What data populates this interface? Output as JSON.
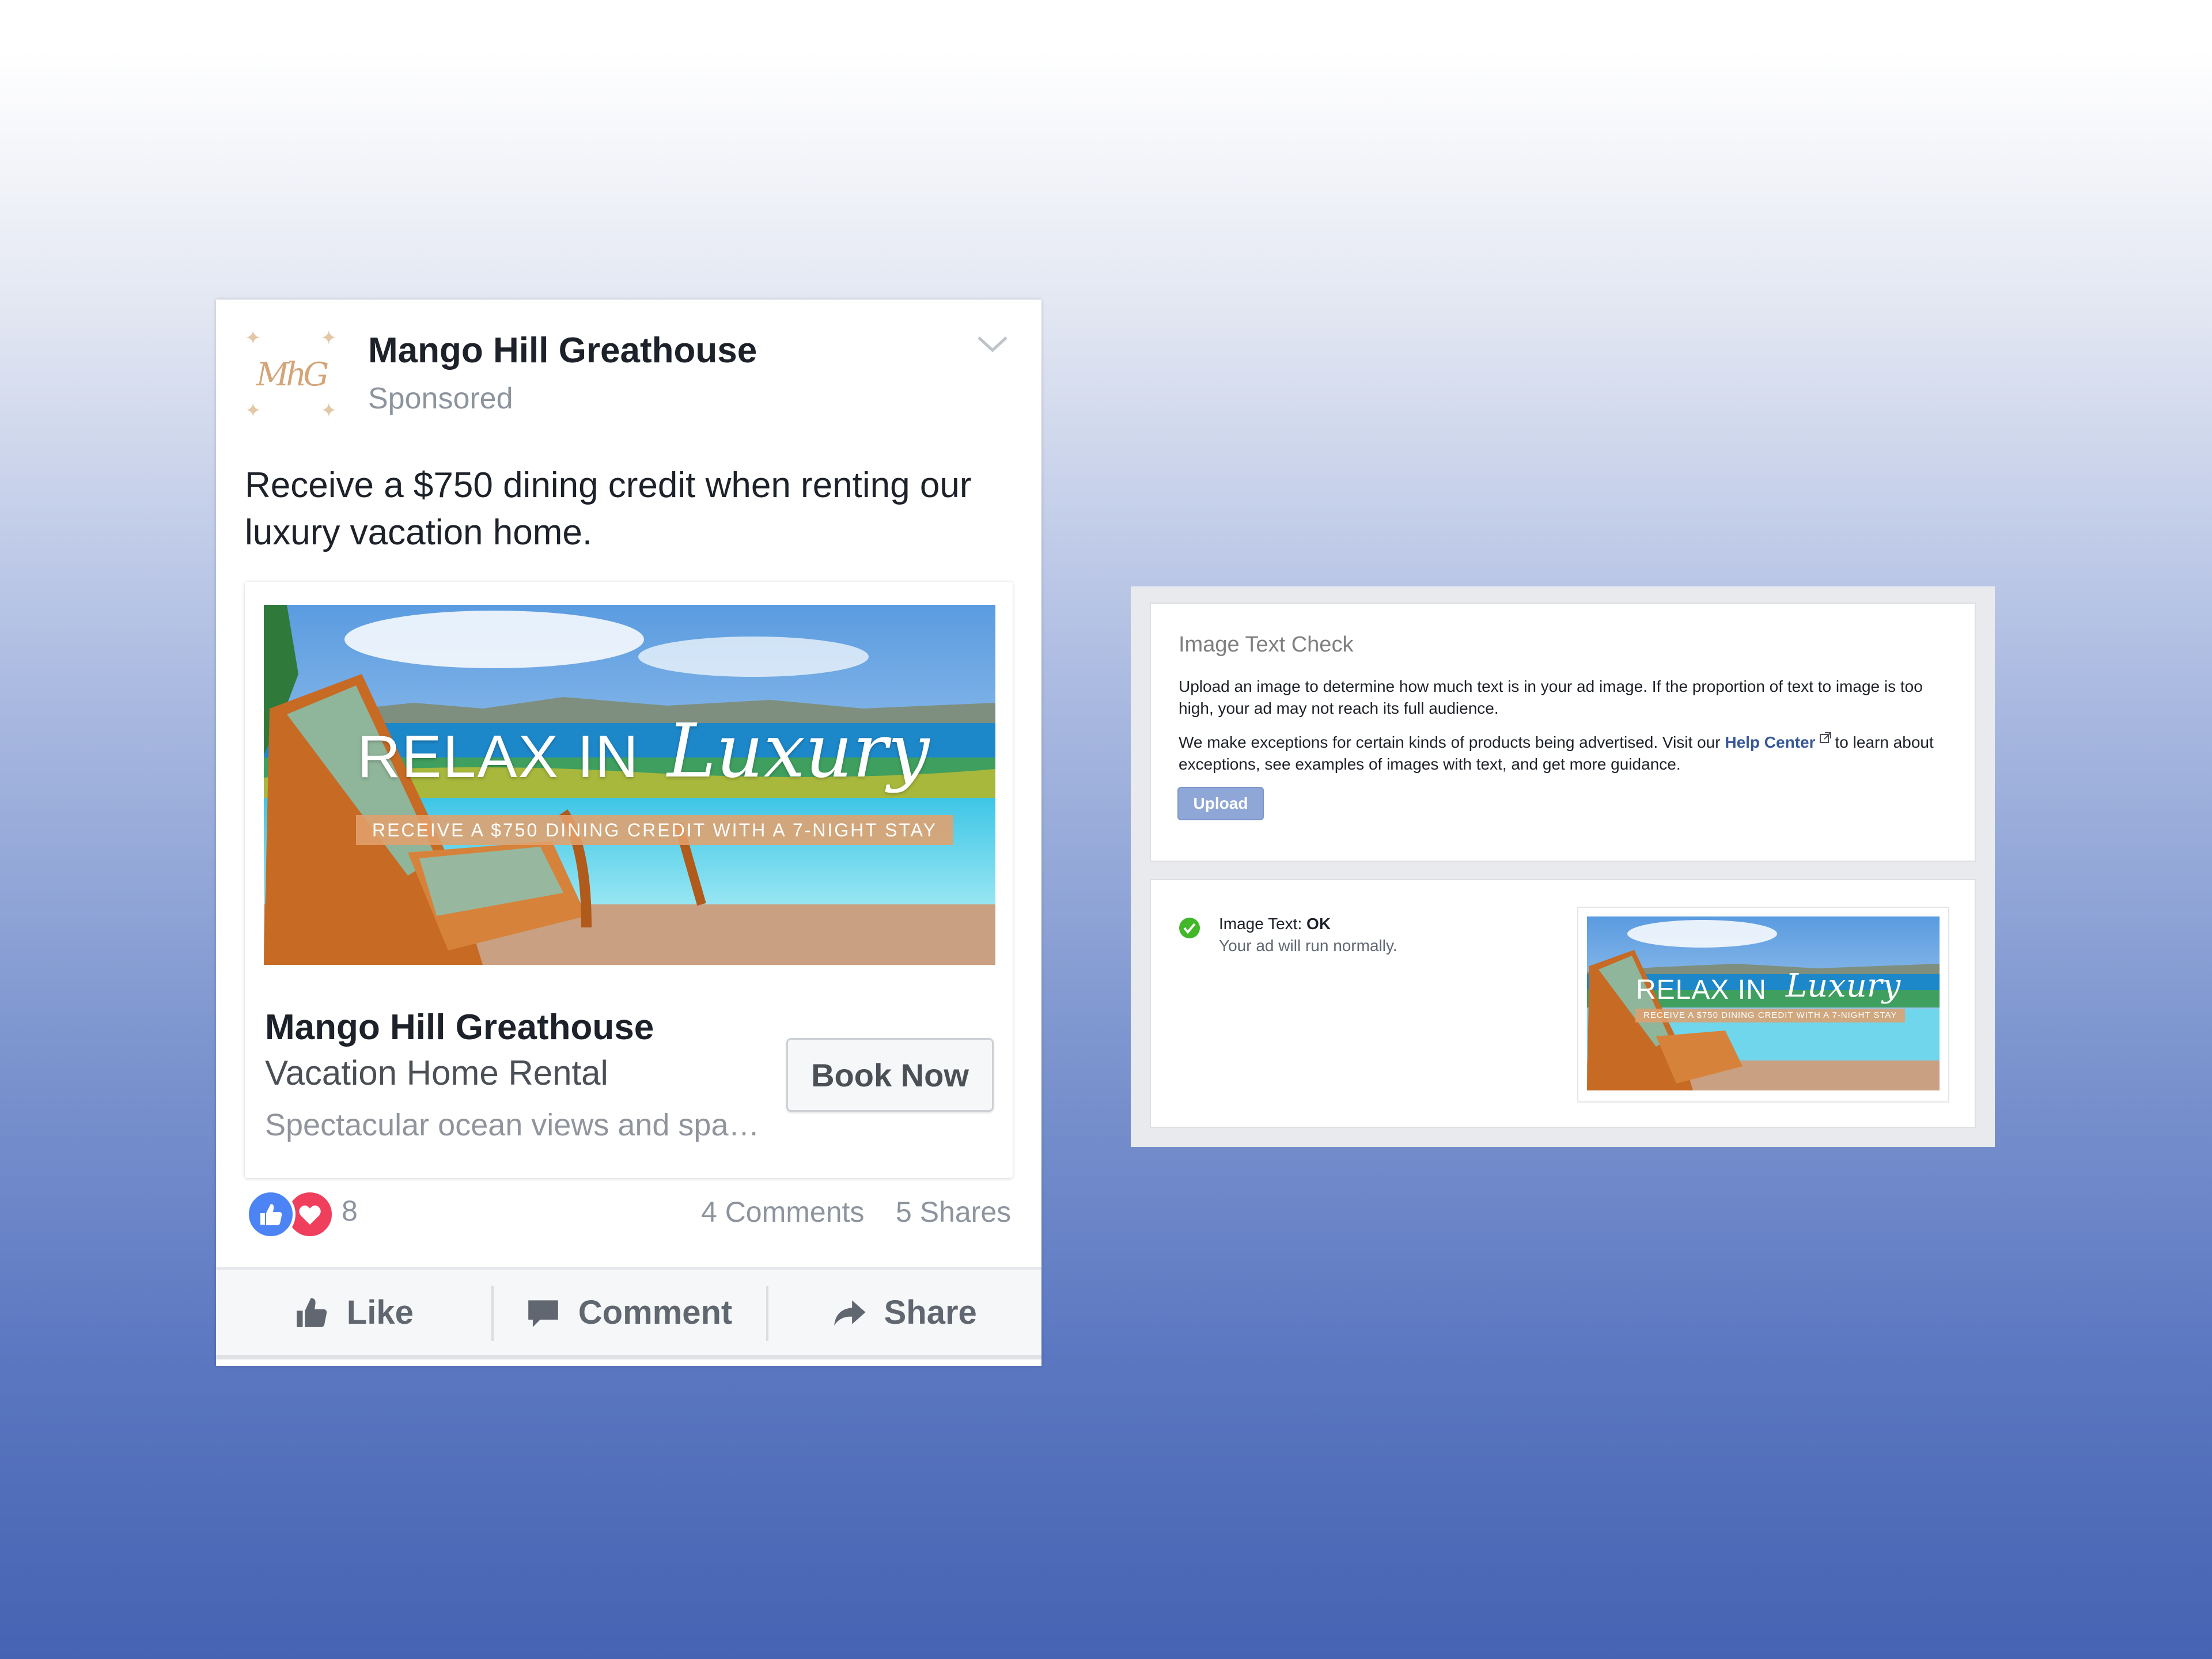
{
  "post": {
    "page_name": "Mango Hill Greathouse",
    "sponsored": "Sponsored",
    "logo_monogram": "MhG",
    "text": "Receive a $750 dining credit when renting our luxury vacation home.",
    "image": {
      "headline": "RELAX IN",
      "script": "Luxury",
      "band": "RECEIVE A $750 DINING CREDIT WITH A 7-NIGHT STAY"
    },
    "link": {
      "title": "Mango Hill Greathouse",
      "subtitle": "Vacation Home Rental",
      "description": "Spectacular ocean views and spa…",
      "cta": "Book Now"
    },
    "stats": {
      "reaction_count": "8",
      "comments": "4 Comments",
      "shares": "5 Shares"
    },
    "actions": {
      "like": "Like",
      "comment": "Comment",
      "share": "Share"
    }
  },
  "text_check": {
    "title": "Image Text Check",
    "paragraph1": "Upload an image to determine how much text is in your ad image. If the proportion of text to image is too high, your ad may not reach its full audience.",
    "paragraph2_before": "We make exceptions for certain kinds of products being advertised. Visit our",
    "help_link": "Help Center",
    "paragraph2_after": "to learn about exceptions, see examples of images with text, and get more guidance.",
    "upload_label": "Upload",
    "result_label": "Image Text:",
    "result_value": "OK",
    "result_sub": "Your ad will run normally.",
    "thumb": {
      "headline": "RELAX IN",
      "script": "Luxury",
      "band": "RECEIVE A $750 DINING CREDIT WITH A 7-NIGHT STAY"
    }
  },
  "colors": {
    "like_blue": "#4d84f5",
    "love_red": "#ef3f5d",
    "link_blue": "#365899",
    "ok_green": "#42b72a",
    "upload_button": "#8fa7d7"
  }
}
